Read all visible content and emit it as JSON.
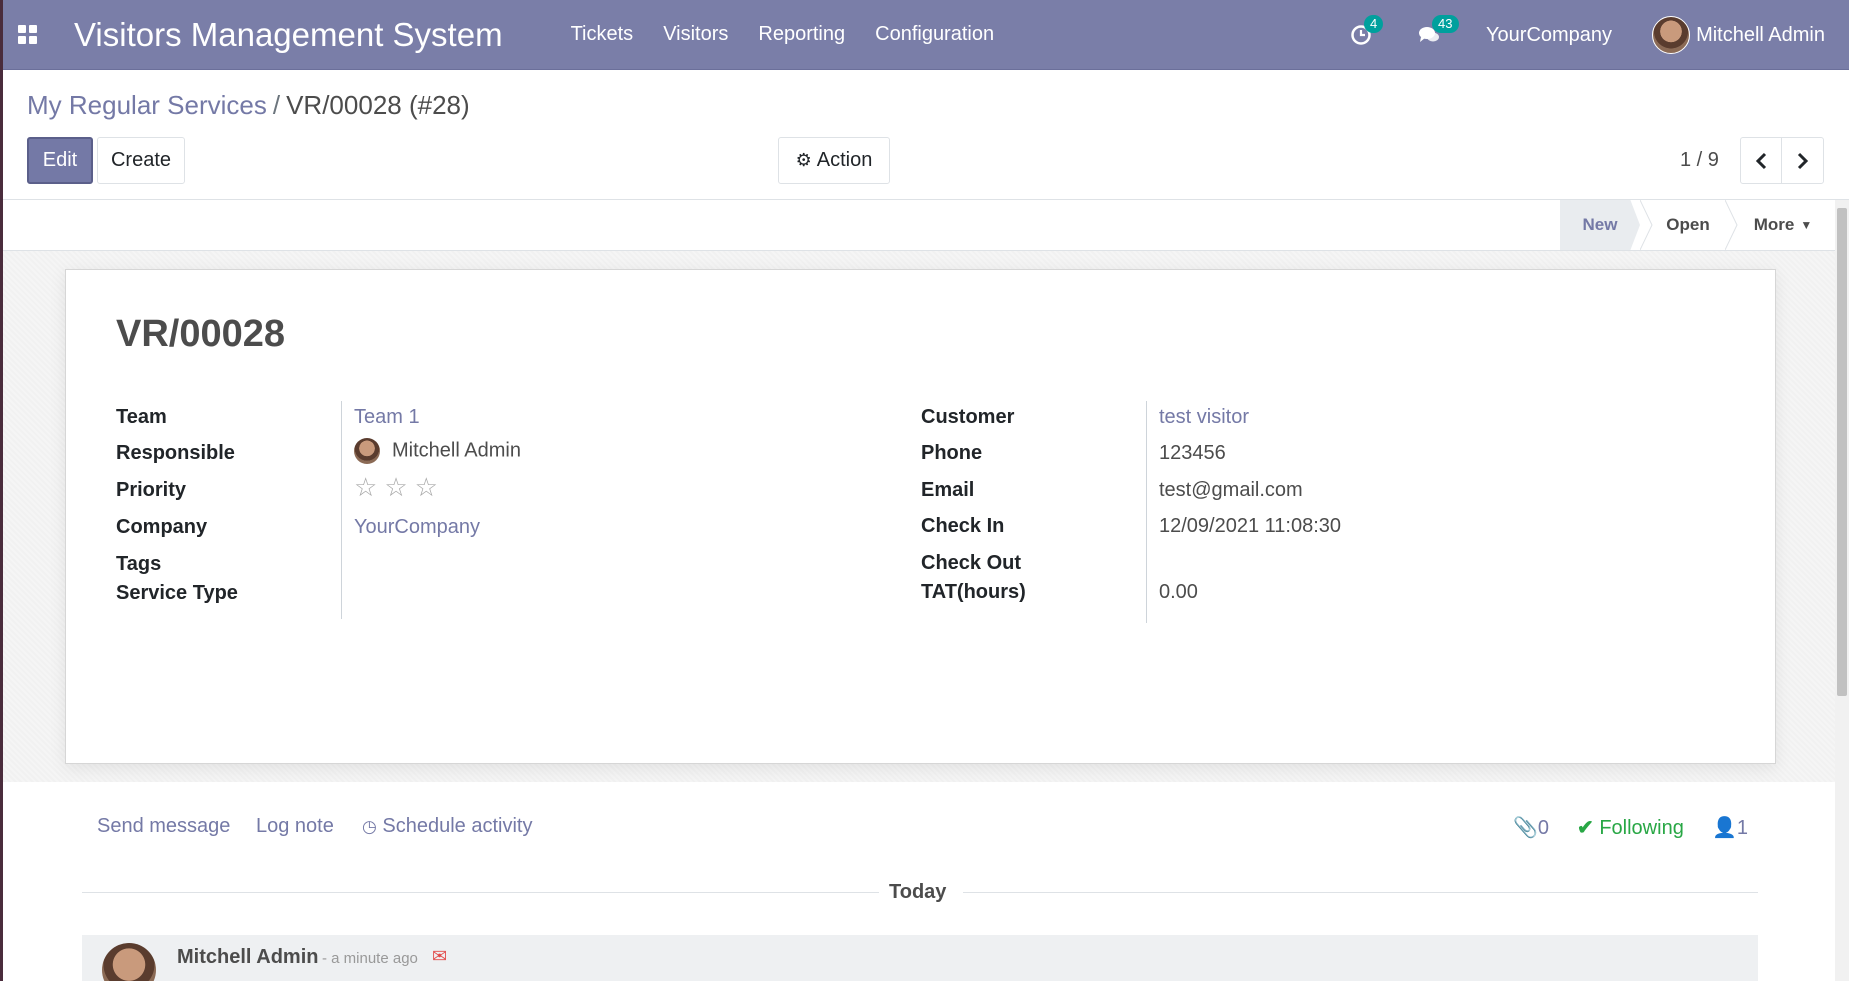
{
  "navbar": {
    "app_title": "Visitors Management System",
    "menu": [
      "Tickets",
      "Visitors",
      "Reporting",
      "Configuration"
    ],
    "activity_count": "4",
    "message_count": "43",
    "company": "YourCompany",
    "user": "Mitchell Admin"
  },
  "breadcrumb": {
    "parent": "My Regular Services",
    "separator": "/",
    "current": "VR/00028 (#28)"
  },
  "buttons": {
    "edit": "Edit",
    "create": "Create",
    "action": "Action"
  },
  "pager": {
    "value": "1 / 9"
  },
  "statusbar": {
    "stages": [
      "New",
      "Open"
    ],
    "more": "More",
    "active": "New"
  },
  "record": {
    "title": "VR/00028",
    "left": [
      {
        "label": "Team",
        "value": "Team 1"
      },
      {
        "label": "Responsible",
        "value": "Mitchell Admin"
      },
      {
        "label": "Priority",
        "value": ""
      },
      {
        "label": "Company",
        "value": "YourCompany"
      },
      {
        "label": "Tags",
        "value": ""
      },
      {
        "label": "Service Type",
        "value": ""
      }
    ],
    "right": [
      {
        "label": "Customer",
        "value": "test visitor"
      },
      {
        "label": "Phone",
        "value": "123456"
      },
      {
        "label": "Email",
        "value": "test@gmail.com"
      },
      {
        "label": "Check In",
        "value": "12/09/2021 11:08:30"
      },
      {
        "label": "Check Out",
        "value": ""
      },
      {
        "label": "TAT(hours)",
        "value": "0.00"
      }
    ],
    "priority_stars": 0,
    "priority_max": 3
  },
  "chatter": {
    "send_message": "Send message",
    "log_note": "Log note",
    "schedule_activity": "Schedule activity",
    "attachments": "0",
    "following": "Following",
    "followers": "1",
    "date_separator": "Today",
    "message": {
      "author": "Mitchell Admin",
      "time": "- a minute ago"
    }
  },
  "colors": {
    "navbar": "#7a7ea8",
    "link": "#7479a6",
    "following": "#28a745",
    "badge": "#00a09d"
  }
}
